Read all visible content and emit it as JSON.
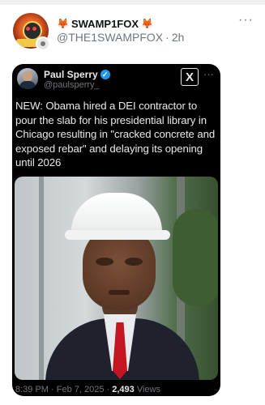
{
  "outer_post": {
    "display_name": "SWAMP1FOX",
    "handle": "@THE1SWAMPFOX",
    "separator": "·",
    "time": "2h",
    "more": "···"
  },
  "embedded_post": {
    "display_name": "Paul Sperry",
    "handle": "@paulsperry_",
    "verified_glyph": "✓",
    "x_logo": "X",
    "more": "···",
    "text": "NEW: Obama hired a DEI contractor to pour the slab for his presidential library in Chicago resulting in \"cracked concrete and exposed rebar\" and delaying its opening until 2026",
    "timestamp": "8:39 PM · Feb 7, 2025 ·",
    "views_count": "2,493",
    "views_label": "Views"
  },
  "colors": {
    "verified": "#1d9bf0",
    "card_background": "#000000",
    "tie": "#c41622"
  },
  "icons": [
    "fox-emoji-icon",
    "verified-badge-icon",
    "x-logo-icon",
    "more-icon"
  ]
}
